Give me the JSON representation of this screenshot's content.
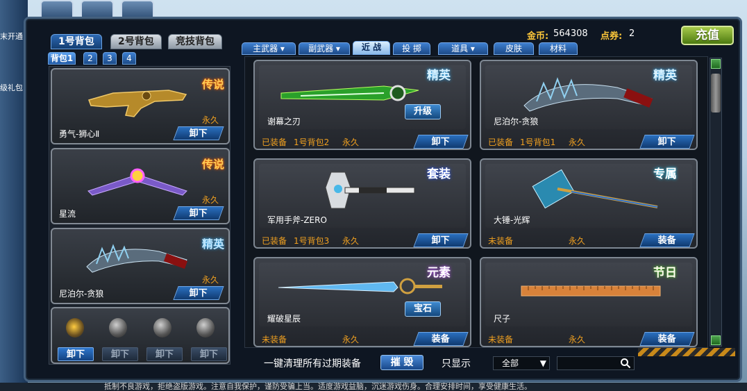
{
  "background": {
    "side_labels": [
      "末开通",
      "级礼包"
    ],
    "bottom_notice": "抵制不良游戏，拒绝盗版游戏。注意自我保护，谨防受骗上当。适度游戏益脑，沉迷游戏伤身。合理安排时间，享受健康生活。"
  },
  "currency": {
    "gold_label": "金币:",
    "gold_value": "564308",
    "voucher_label": "点券:",
    "voucher_value": "2"
  },
  "recharge_label": "充值",
  "pack_tabs": [
    "1号背包",
    "2号背包",
    "竞技背包"
  ],
  "sub_tabs": [
    "背包1",
    "2",
    "3",
    "4"
  ],
  "category_tabs": [
    {
      "label": "主武器",
      "has_dropdown": true
    },
    {
      "label": "副武器",
      "has_dropdown": true
    },
    {
      "label": "近 战",
      "has_dropdown": false
    },
    {
      "label": "投 掷",
      "has_dropdown": false
    },
    {
      "label": "道具",
      "has_dropdown": true
    },
    {
      "label": "皮肤",
      "has_dropdown": false
    },
    {
      "label": "材料",
      "has_dropdown": false
    }
  ],
  "loadout": [
    {
      "name": "勇气-狮心Ⅱ",
      "tier": "传说",
      "duration": "永久",
      "action": "卸下"
    },
    {
      "name": "星流",
      "tier": "传说",
      "duration": "永久",
      "action": "卸下"
    },
    {
      "name": "尼泊尔-贪狼",
      "tier": "精英",
      "duration": "永久",
      "action": "卸下"
    }
  ],
  "throwables": {
    "buttons": [
      "卸下",
      "卸下",
      "卸下",
      "卸下"
    ]
  },
  "items": [
    {
      "name": "谢幕之刃",
      "tier": "精英",
      "status": "已装备",
      "pack": "1号背包2",
      "duration": "永久",
      "action": "卸下",
      "badge": "升级"
    },
    {
      "name": "尼泊尔-贪狼",
      "tier": "精英",
      "status": "已装备",
      "pack": "1号背包1",
      "duration": "永久",
      "action": "卸下",
      "badge": ""
    },
    {
      "name": "军用手斧-ZERO",
      "tier": "套装",
      "status": "已装备",
      "pack": "1号背包3",
      "duration": "永久",
      "action": "卸下",
      "badge": ""
    },
    {
      "name": "大锤-光辉",
      "tier": "专属",
      "status": "未装备",
      "pack": "",
      "duration": "永久",
      "action": "装备",
      "badge": ""
    },
    {
      "name": "耀破星辰",
      "tier": "元素",
      "status": "未装备",
      "pack": "",
      "duration": "永久",
      "action": "装备",
      "badge": "宝石"
    },
    {
      "name": "尺子",
      "tier": "节日",
      "status": "未装备",
      "pack": "",
      "duration": "永久",
      "action": "装备",
      "badge": ""
    }
  ],
  "bottom": {
    "clear_label": "一键清理所有过期装备",
    "destroy_label": "摧 毁",
    "filter_label": "只显示",
    "filter_value": "全部"
  }
}
